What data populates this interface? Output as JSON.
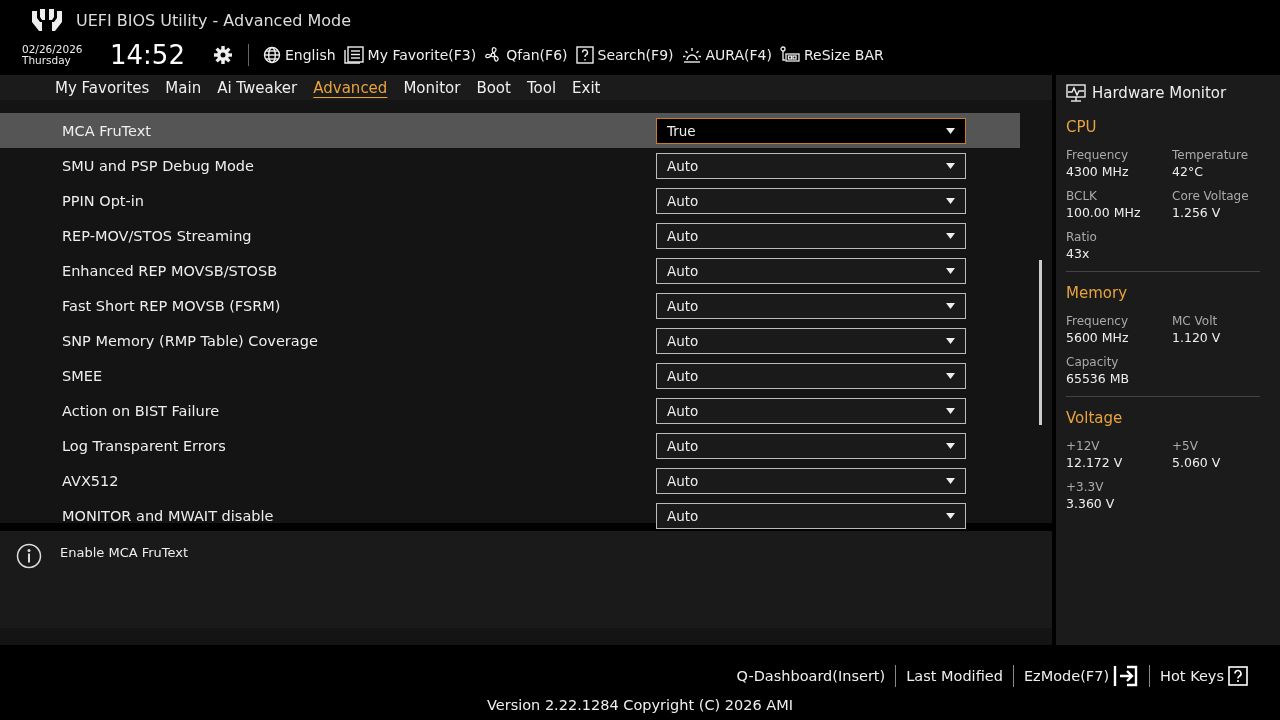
{
  "window": {
    "title": "UEFI BIOS Utility - Advanced Mode"
  },
  "header": {
    "date": "02/26/2026",
    "day": "Thursday",
    "time": "14:52",
    "tools": [
      {
        "kind": "language",
        "label": "English"
      },
      {
        "kind": "favorite",
        "label": "My Favorite(F3)"
      },
      {
        "kind": "fan",
        "label": "Qfan(F6)"
      },
      {
        "kind": "search",
        "label": "Search(F9)"
      },
      {
        "kind": "aura",
        "label": "AURA(F4)"
      },
      {
        "kind": "resize",
        "label": "ReSize BAR"
      }
    ]
  },
  "tabs": [
    {
      "label": "My Favorites",
      "selected": false
    },
    {
      "label": "Main",
      "selected": false
    },
    {
      "label": "Ai Tweaker",
      "selected": false
    },
    {
      "label": "Advanced",
      "selected": true
    },
    {
      "label": "Monitor",
      "selected": false
    },
    {
      "label": "Boot",
      "selected": false
    },
    {
      "label": "Tool",
      "selected": false
    },
    {
      "label": "Exit",
      "selected": false
    }
  ],
  "settings": [
    {
      "label": "MCA FruText",
      "value": "True",
      "selected": true
    },
    {
      "label": "SMU and PSP Debug Mode",
      "value": "Auto",
      "selected": false
    },
    {
      "label": "PPIN Opt-in",
      "value": "Auto",
      "selected": false
    },
    {
      "label": "REP-MOV/STOS Streaming",
      "value": "Auto",
      "selected": false
    },
    {
      "label": "Enhanced REP MOVSB/STOSB",
      "value": "Auto",
      "selected": false
    },
    {
      "label": "Fast Short REP MOVSB (FSRM)",
      "value": "Auto",
      "selected": false
    },
    {
      "label": "SNP Memory (RMP Table) Coverage",
      "value": "Auto",
      "selected": false
    },
    {
      "label": "SMEE",
      "value": "Auto",
      "selected": false
    },
    {
      "label": "Action on BIST Failure",
      "value": "Auto",
      "selected": false
    },
    {
      "label": "Log Transparent Errors",
      "value": "Auto",
      "selected": false
    },
    {
      "label": "AVX512",
      "value": "Auto",
      "selected": false
    },
    {
      "label": "MONITOR and MWAIT disable",
      "value": "Auto",
      "selected": false
    }
  ],
  "help": {
    "text": "Enable MCA FruText"
  },
  "hardware_monitor": {
    "title": "Hardware Monitor",
    "sections": [
      {
        "title": "CPU",
        "items": [
          {
            "label": "Frequency",
            "value": "4300 MHz"
          },
          {
            "label": "Temperature",
            "value": "42°C"
          },
          {
            "label": "BCLK",
            "value": "100.00 MHz"
          },
          {
            "label": "Core Voltage",
            "value": "1.256 V"
          },
          {
            "label": "Ratio",
            "value": "43x"
          }
        ]
      },
      {
        "title": "Memory",
        "items": [
          {
            "label": "Frequency",
            "value": "5600 MHz"
          },
          {
            "label": "MC Volt",
            "value": "1.120 V"
          },
          {
            "label": "Capacity",
            "value": "65536 MB"
          }
        ]
      },
      {
        "title": "Voltage",
        "items": [
          {
            "label": "+12V",
            "value": "12.172 V"
          },
          {
            "label": "+5V",
            "value": "5.060 V"
          },
          {
            "label": "+3.3V",
            "value": "3.360 V"
          }
        ]
      }
    ]
  },
  "footer": {
    "actions": [
      {
        "label": "Q-Dashboard(Insert)",
        "kind": "plain"
      },
      {
        "label": "Last Modified",
        "kind": "plain"
      },
      {
        "label": "EzMode(F7)",
        "kind": "mode"
      },
      {
        "label": "Hot Keys",
        "kind": "keys"
      }
    ],
    "version": "Version 2.22.1284 Copyright (C) 2026 AMI"
  }
}
